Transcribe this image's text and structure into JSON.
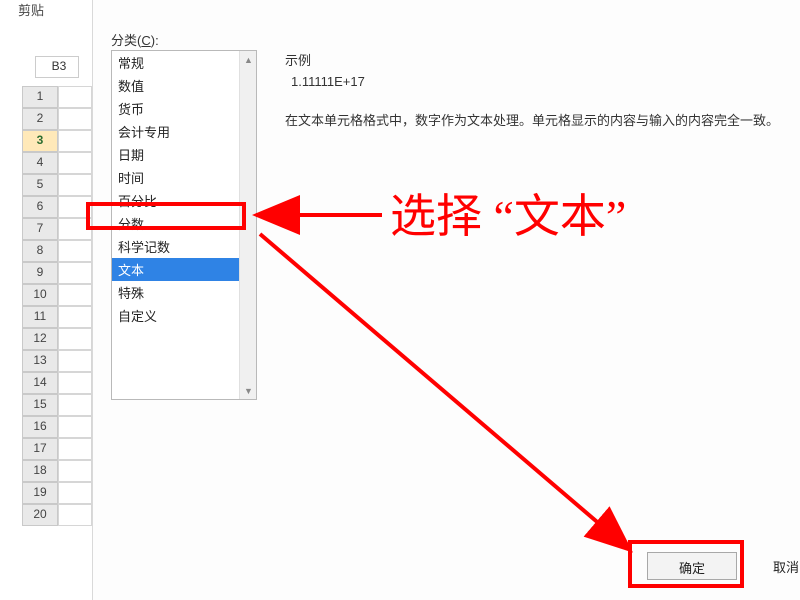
{
  "ribbon": {
    "clipboard_fragment": "剪贴"
  },
  "name_box": {
    "value": "B3"
  },
  "sheet": {
    "partial_label_1": "",
    "partial_label_2": "",
    "row_headers": [
      "1",
      "2",
      "3",
      "4",
      "5",
      "6",
      "7",
      "8",
      "9",
      "10",
      "11",
      "12",
      "13",
      "14",
      "15",
      "16",
      "17",
      "18",
      "19",
      "20"
    ],
    "selected_row_index": 2
  },
  "dialog": {
    "category_label_prefix": "分类(",
    "category_mnemonic": "C",
    "category_label_suffix": "):",
    "categories": [
      "常规",
      "数值",
      "货币",
      "会计专用",
      "日期",
      "时间",
      "百分比",
      "分数",
      "科学记数",
      "文本",
      "特殊",
      "自定义"
    ],
    "selected_category_index": 9,
    "example_label": "示例",
    "example_value": "1.11111E+17",
    "description": "在文本单元格格式中，数字作为文本处理。单元格显示的内容与输入的内容完全一致。",
    "ok_label": "确定",
    "cancel_label_fragment": "取消"
  },
  "annotation": {
    "instruction": "选择 “文本”"
  }
}
